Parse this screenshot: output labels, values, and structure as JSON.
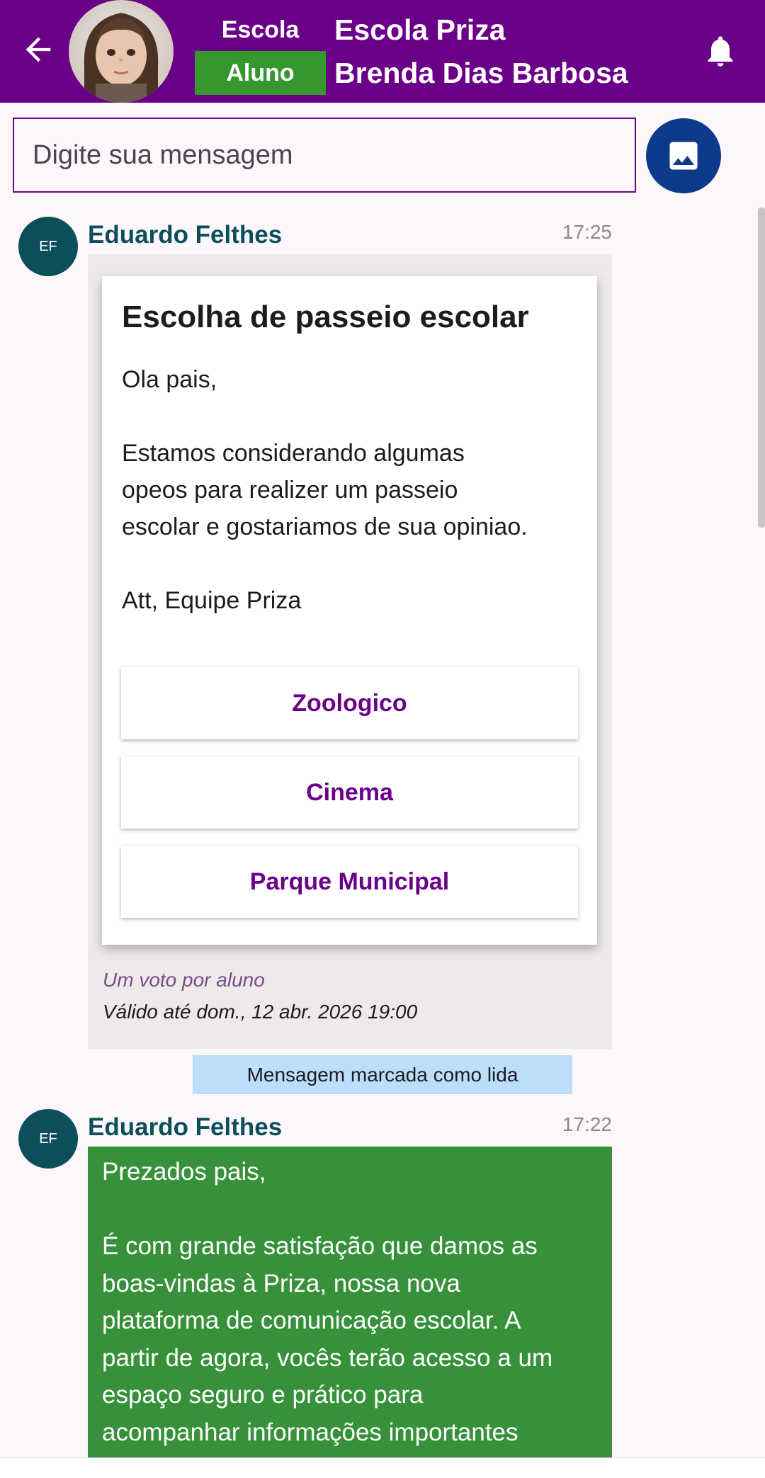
{
  "header": {
    "back_icon": "arrow-left-icon",
    "school_label": "Escola",
    "student_label": "Aluno",
    "school_name": "Escola Priza",
    "student_name": "Brenda Dias Barbosa",
    "notification_icon": "bell-icon"
  },
  "composer": {
    "placeholder": "Digite sua mensagem",
    "image_button_icon": "image-icon"
  },
  "messages": [
    {
      "initials": "EF",
      "sender": "Eduardo Felthes",
      "time": "17:25",
      "poll": {
        "title": "Escolha de passeio escolar",
        "body_lines": [
          "Ola pais,",
          "",
          "Estamos considerando algumas",
          "opeos para realizer um passeio",
          "escolar e gostariamos de sua opiniao.",
          "",
          "Att, Equipe Priza"
        ],
        "options": [
          "Zoologico",
          "Cinema",
          "Parque Municipal"
        ],
        "vote_note": "Um voto por aluno",
        "valid_until": "Válido até dom., 12 abr. 2026 19:00"
      },
      "read_status": "Mensagem marcada como lida"
    },
    {
      "initials": "EF",
      "sender": "Eduardo Felthes",
      "time": "17:22",
      "body_lines": [
        "Prezados pais,",
        "",
        "É com grande satisfação que damos as",
        "boas-vindas à Priza, nossa nova",
        "plataforma de comunicação escolar. A",
        "partir de agora, vocês terão acesso a um",
        "espaço seguro e prático para",
        "acompanhar informações importantes"
      ]
    }
  ],
  "colors": {
    "header_bg": "#6b0088",
    "student_badge_bg": "#34982f",
    "image_button_bg": "#0e3a8c",
    "sender_color": "#0c4f5c",
    "option_text": "#6b0088",
    "read_chip_bg": "#bbdefb",
    "green_bubble_bg": "#37913a"
  }
}
